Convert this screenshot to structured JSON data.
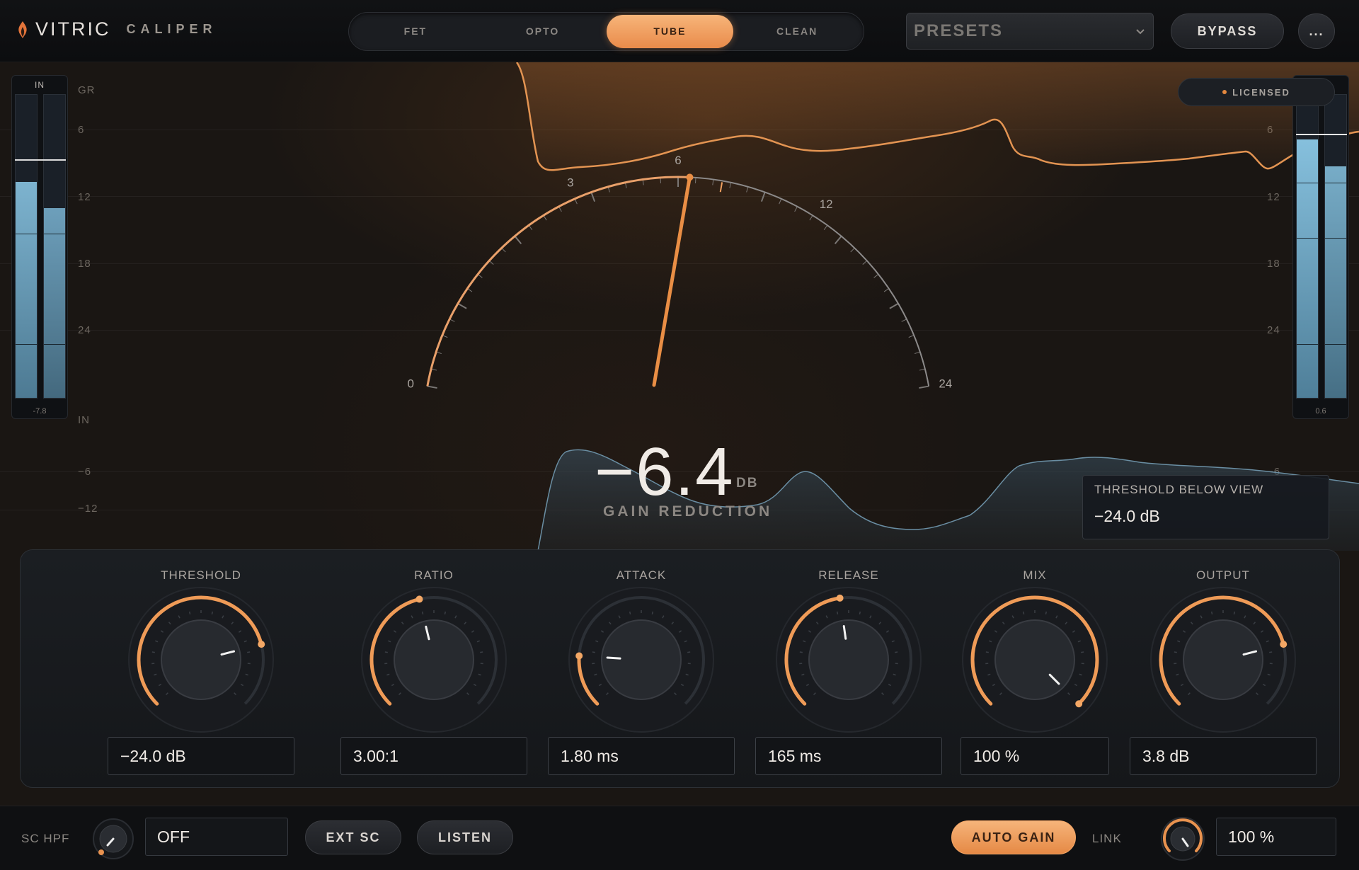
{
  "header": {
    "brand": "VITRIC",
    "product": "CALIPER",
    "modes": [
      {
        "label": "FET",
        "active": false
      },
      {
        "label": "OPTO",
        "active": false
      },
      {
        "label": "TUBE",
        "active": true
      },
      {
        "label": "CLEAN",
        "active": false
      }
    ],
    "presets_label": "PRESETS",
    "bypass_label": "BYPASS",
    "more_label": "..."
  },
  "display": {
    "gr_axis_title": "GR",
    "gr_ticks": [
      "6",
      "12",
      "18",
      "24"
    ],
    "in_axis_title": "IN",
    "in_ticks": [
      "−6",
      "−12"
    ],
    "right_ticks": [
      "6",
      "12",
      "18",
      "24",
      "−6"
    ],
    "input_meter": {
      "title": "IN",
      "value": "-7.8"
    },
    "output_meter": {
      "value": "0.6"
    },
    "licensed_label": "LICENSED",
    "dial_ticks": [
      "0",
      "3",
      "6",
      "12",
      "24"
    ],
    "gain_reduction_value": "−6.4",
    "gain_reduction_unit": "DB",
    "gain_reduction_label": "GAIN REDUCTION",
    "threshold_box": {
      "title": "THRESHOLD BELOW VIEW",
      "value": "−24.0 dB"
    }
  },
  "knobs": [
    {
      "label": "THRESHOLD",
      "value": "−24.0 dB",
      "level": 0.78
    },
    {
      "label": "RATIO",
      "value": "3.00:1",
      "level": 0.45
    },
    {
      "label": "ATTACK",
      "value": "1.80 ms",
      "level": 0.18
    },
    {
      "label": "RELEASE",
      "value": "165 ms",
      "level": 0.47
    },
    {
      "label": "MIX",
      "value": "100 %",
      "level": 1.0
    },
    {
      "label": "OUTPUT",
      "value": "3.8 dB",
      "level": 0.78
    }
  ],
  "footer": {
    "sc_hpf_label": "SC HPF",
    "sc_hpf_value": "OFF",
    "ext_sc_label": "EXT SC",
    "listen_label": "LISTEN",
    "auto_gain_label": "AUTO GAIN",
    "link_label": "LINK",
    "link_value": "100 %"
  },
  "colors": {
    "accent": "#f0a060",
    "meter_blue": "#6fa6c4",
    "background": "#1a1613"
  }
}
